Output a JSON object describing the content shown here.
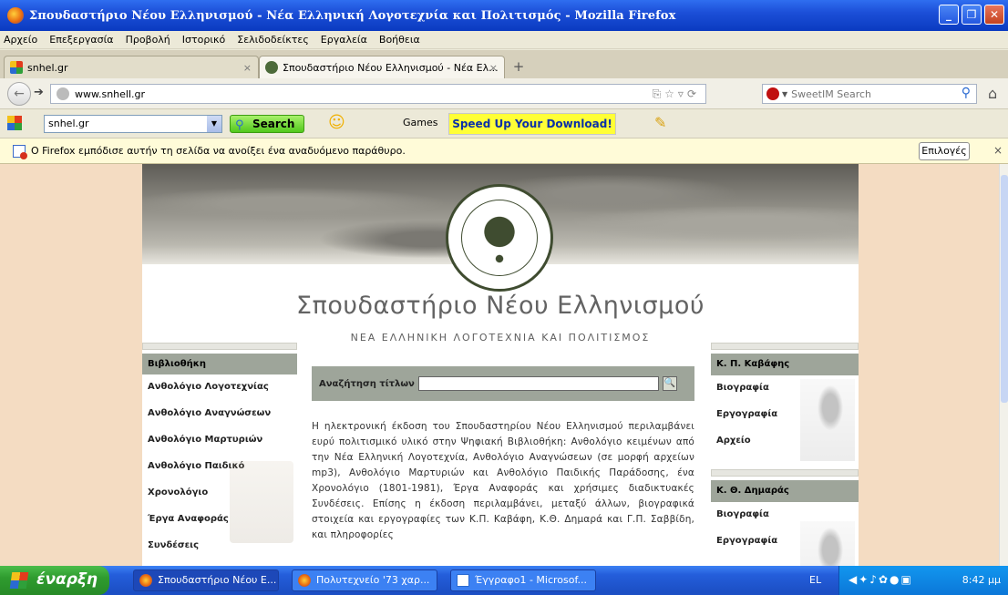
{
  "window": {
    "title": "Σπουδαστήριο Νέου Ελληνισμού - Νέα Ελληνική Λογοτεχνία και Πολιτισμός - Mozilla Firefox",
    "controls": [
      "_",
      "❐",
      "✕"
    ]
  },
  "menu": [
    "Αρχείο",
    "Επεξεργασία",
    "Προβολή",
    "Ιστορικό",
    "Σελιδοδείκτες",
    "Εργαλεία",
    "Βοήθεια"
  ],
  "tabs": [
    {
      "label": "snhel.gr",
      "close": "×"
    },
    {
      "label": "Σπουδαστήριο Νέου Ελληνισμού - Νέα Ελ...",
      "close": "×"
    }
  ],
  "newtab": "+",
  "nav": {
    "back": "←",
    "forward": "➔",
    "url": "www.snhell.gr",
    "search_placeholder": "SweetIM Search",
    "home": "⌂"
  },
  "toolbar2": {
    "combo_value": "snhel.gr",
    "search_label": "Search",
    "games_label": "Games",
    "speed_label": "Speed Up Your Download!"
  },
  "notification": {
    "text": "Ο Firefox εμπόδισε αυτήν τη σελίδα να ανοίξει ένα αναδυόμενο παράθυρο.",
    "options_label": "Επιλογές",
    "close": "×"
  },
  "site": {
    "title": "Σπουδαστήριο Νέου Ελληνισμού",
    "subtitle": "ΝΕΑ ΕΛΛΗΝΙΚΗ ΛΟΓΟΤΕΧΝΙΑ ΚΑΙ ΠΟΛΙΤΙΣΜΟΣ",
    "left_header": "Βιβλιοθήκη",
    "left_items": [
      "Ανθολόγιο Λογοτεχνίας",
      "Ανθολόγιο Αναγνώσεων",
      "Ανθολόγιο Μαρτυριών",
      "Ανθολόγιο Παιδικό",
      "Χρονολόγιο",
      "Έργα Αναφοράς",
      "Συνδέσεις"
    ],
    "search_label": "Αναζήτηση τίτλων",
    "search_button": "🔍",
    "paragraph": "Η ηλεκτρονική έκδοση του Σπουδαστηρίου Νέου Ελληνισμού περιλαμβάνει ευρύ πολιτισμικό υλικό στην Ψηφιακή Βιβλιοθήκη: Ανθολόγιο κειμένων από την Νέα Ελληνική Λογοτεχνία, Ανθολόγιο Αναγνώσεων (σε μορφή αρχείων mp3), Ανθολόγιο Μαρτυριών και Ανθολόγιο Παιδικής Παράδοσης, ένα Χρονολόγιο (1801-1981), Έργα Αναφοράς και χρήσιμες διαδικτυακές Συνδέσεις. Επίσης η έκδοση περιλαμβάνει, μεταξύ άλλων, βιογραφικά στοιχεία και εργογραφίες των Κ.Π. Καβάφη, Κ.Θ. Δημαρά και Γ.Π. Σαββίδη, και πληροφορίες",
    "right_sections": [
      {
        "header": "Κ. Π. Καβάφης",
        "items": [
          "Βιογραφία",
          "Εργογραφία",
          "Αρχείο"
        ]
      },
      {
        "header": "Κ. Θ. Δημαράς",
        "items": [
          "Βιογραφία",
          "Εργογραφία"
        ]
      }
    ]
  },
  "taskbar": {
    "start_label": "έναρξη",
    "items": [
      "Σπουδαστήριο Νέου Ε...",
      "Πολυτεχνείο '73 χαρ...",
      "Έγγραφο1 - Microsof..."
    ],
    "lang": "EL",
    "clock": "8:42 μμ"
  }
}
